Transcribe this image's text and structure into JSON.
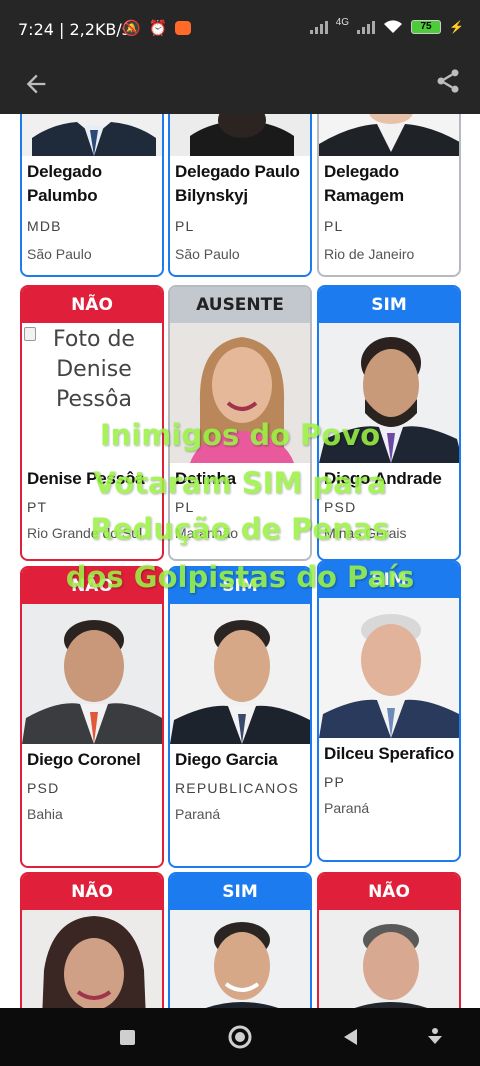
{
  "status_bar": {
    "time": "7:24 | 2,2KB/s",
    "network": "4G",
    "battery": "75"
  },
  "cards": [
    {
      "vote": "",
      "name": "Delegado Palumbo",
      "party": "MDB",
      "state": "São Paulo"
    },
    {
      "vote": "",
      "name": "Delegado Paulo Bilynskyj",
      "party": "PL",
      "state": "São Paulo"
    },
    {
      "vote": "",
      "name": "Delegado Ramagem",
      "party": "PL",
      "state": "Rio de Janeiro"
    },
    {
      "vote": "NÃO",
      "name": "Denise Pessôa",
      "party": "PT",
      "state": "Rio Grande do Sul",
      "photo_alt": "Foto de Denise Pessôa"
    },
    {
      "vote": "AUSENTE",
      "name": "Detinha",
      "party": "PL",
      "state": "Maranhão"
    },
    {
      "vote": "SIM",
      "name": "Diego Andrade",
      "party": "PSD",
      "state": "Minas Gerais"
    },
    {
      "vote": "NÃO",
      "name": "Diego Coronel",
      "party": "PSD",
      "state": "Bahia"
    },
    {
      "vote": "SIM",
      "name": "Diego Garcia",
      "party": "REPUBLICANOS",
      "state": "Paraná"
    },
    {
      "vote": "SIM",
      "name": "Dilceu Sperafico",
      "party": "PP",
      "state": "Paraná"
    },
    {
      "vote": "NÃO",
      "name": "",
      "party": "",
      "state": ""
    },
    {
      "vote": "SIM",
      "name": "",
      "party": "",
      "state": ""
    },
    {
      "vote": "NÃO",
      "name": "",
      "party": "",
      "state": ""
    }
  ],
  "overlay": {
    "line1": "Inimigos do Povo",
    "line2": "Votaram SIM para",
    "line3": "Redução de Penas",
    "line4": "dos Golpistas do País"
  },
  "colors": {
    "nao": "#e0203a",
    "sim": "#1b7bef",
    "ausente": "#c3c8ce",
    "overlay_text": "#9bf244",
    "app_bar": "#262626"
  },
  "icons": {
    "back": "arrow-left-icon",
    "share": "share-icon",
    "nav_recents": "square-icon",
    "nav_home": "circle-icon",
    "nav_back": "triangle-icon",
    "nav_extra": "down-arrow-icon"
  }
}
